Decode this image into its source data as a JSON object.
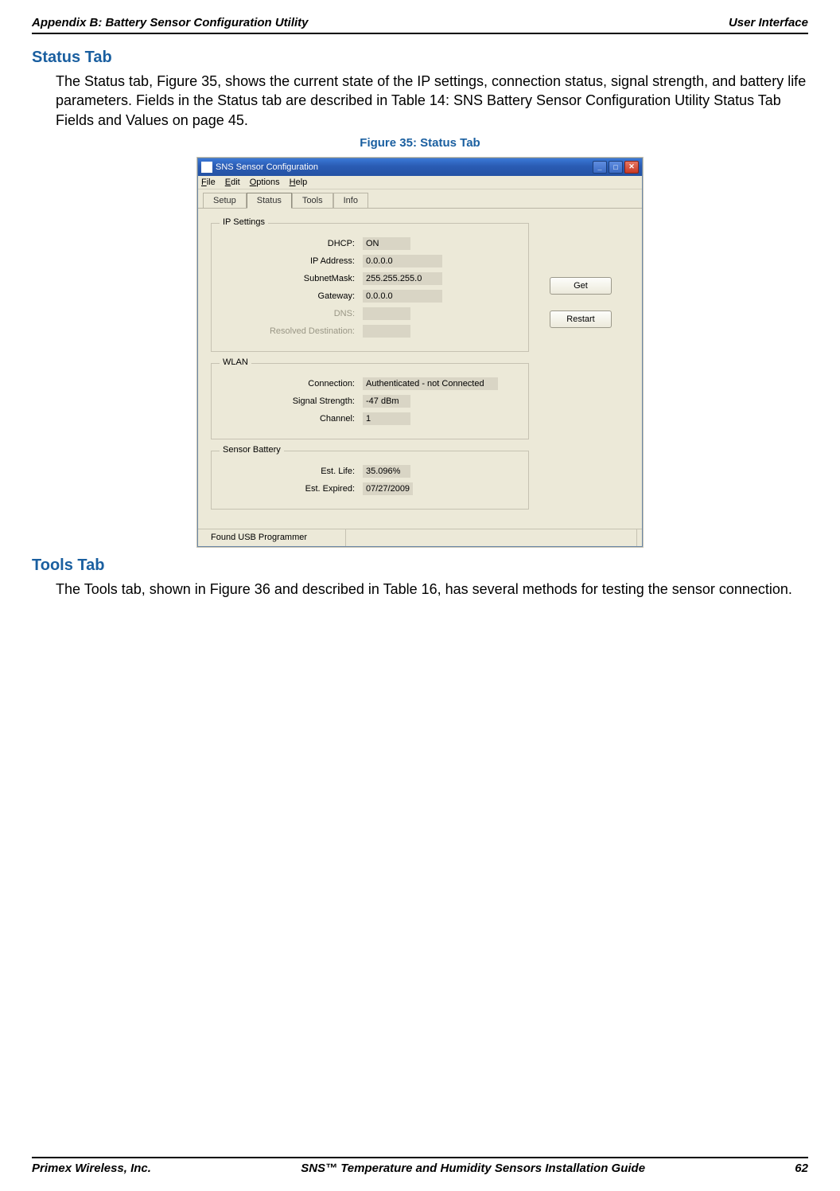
{
  "header": {
    "left": "Appendix B: Battery Sensor Configuration Utility",
    "right": "User Interface"
  },
  "sections": {
    "status": {
      "heading": "Status Tab",
      "paragraph": "The Status tab, Figure 35, shows the current state of the IP settings, connection status, signal strength, and battery life parameters. Fields in the Status tab are described in Table 14: SNS Battery Sensor Configuration Utility Status Tab Fields and Values on page 45.",
      "figure_caption": "Figure 35: Status Tab"
    },
    "tools": {
      "heading": "Tools Tab",
      "paragraph": "The Tools tab, shown in Figure 36 and described in Table 16, has several methods for testing the sensor connection."
    }
  },
  "screenshot": {
    "title": "SNS Sensor Configuration",
    "menu": {
      "file": "File",
      "edit": "Edit",
      "options": "Options",
      "help": "Help"
    },
    "tabs": {
      "setup": "Setup",
      "status": "Status",
      "tools": "Tools",
      "info": "Info"
    },
    "buttons": {
      "get": "Get",
      "restart": "Restart"
    },
    "groups": {
      "ip": {
        "legend": "IP Settings",
        "rows": {
          "dhcp": {
            "label": "DHCP:",
            "value": "ON"
          },
          "ip": {
            "label": "IP Address:",
            "value": "0.0.0.0"
          },
          "subnet": {
            "label": "SubnetMask:",
            "value": "255.255.255.0"
          },
          "gateway": {
            "label": "Gateway:",
            "value": "0.0.0.0"
          },
          "dns": {
            "label": "DNS:",
            "value": ""
          },
          "resolved": {
            "label": "Resolved Destination:",
            "value": ""
          }
        }
      },
      "wlan": {
        "legend": "WLAN",
        "rows": {
          "conn": {
            "label": "Connection:",
            "value": "Authenticated - not Connected"
          },
          "signal": {
            "label": "Signal Strength:",
            "value": "-47 dBm"
          },
          "channel": {
            "label": "Channel:",
            "value": "1"
          }
        }
      },
      "battery": {
        "legend": "Sensor Battery",
        "rows": {
          "life": {
            "label": "Est. Life:",
            "value": "35.096%"
          },
          "expired": {
            "label": "Est. Expired:",
            "value": "07/27/2009"
          }
        }
      }
    },
    "statusbar": {
      "msg": "Found USB Programmer"
    }
  },
  "footer": {
    "left": "Primex Wireless, Inc.",
    "center": "SNS™ Temperature and Humidity Sensors Installation Guide",
    "right": "62"
  }
}
